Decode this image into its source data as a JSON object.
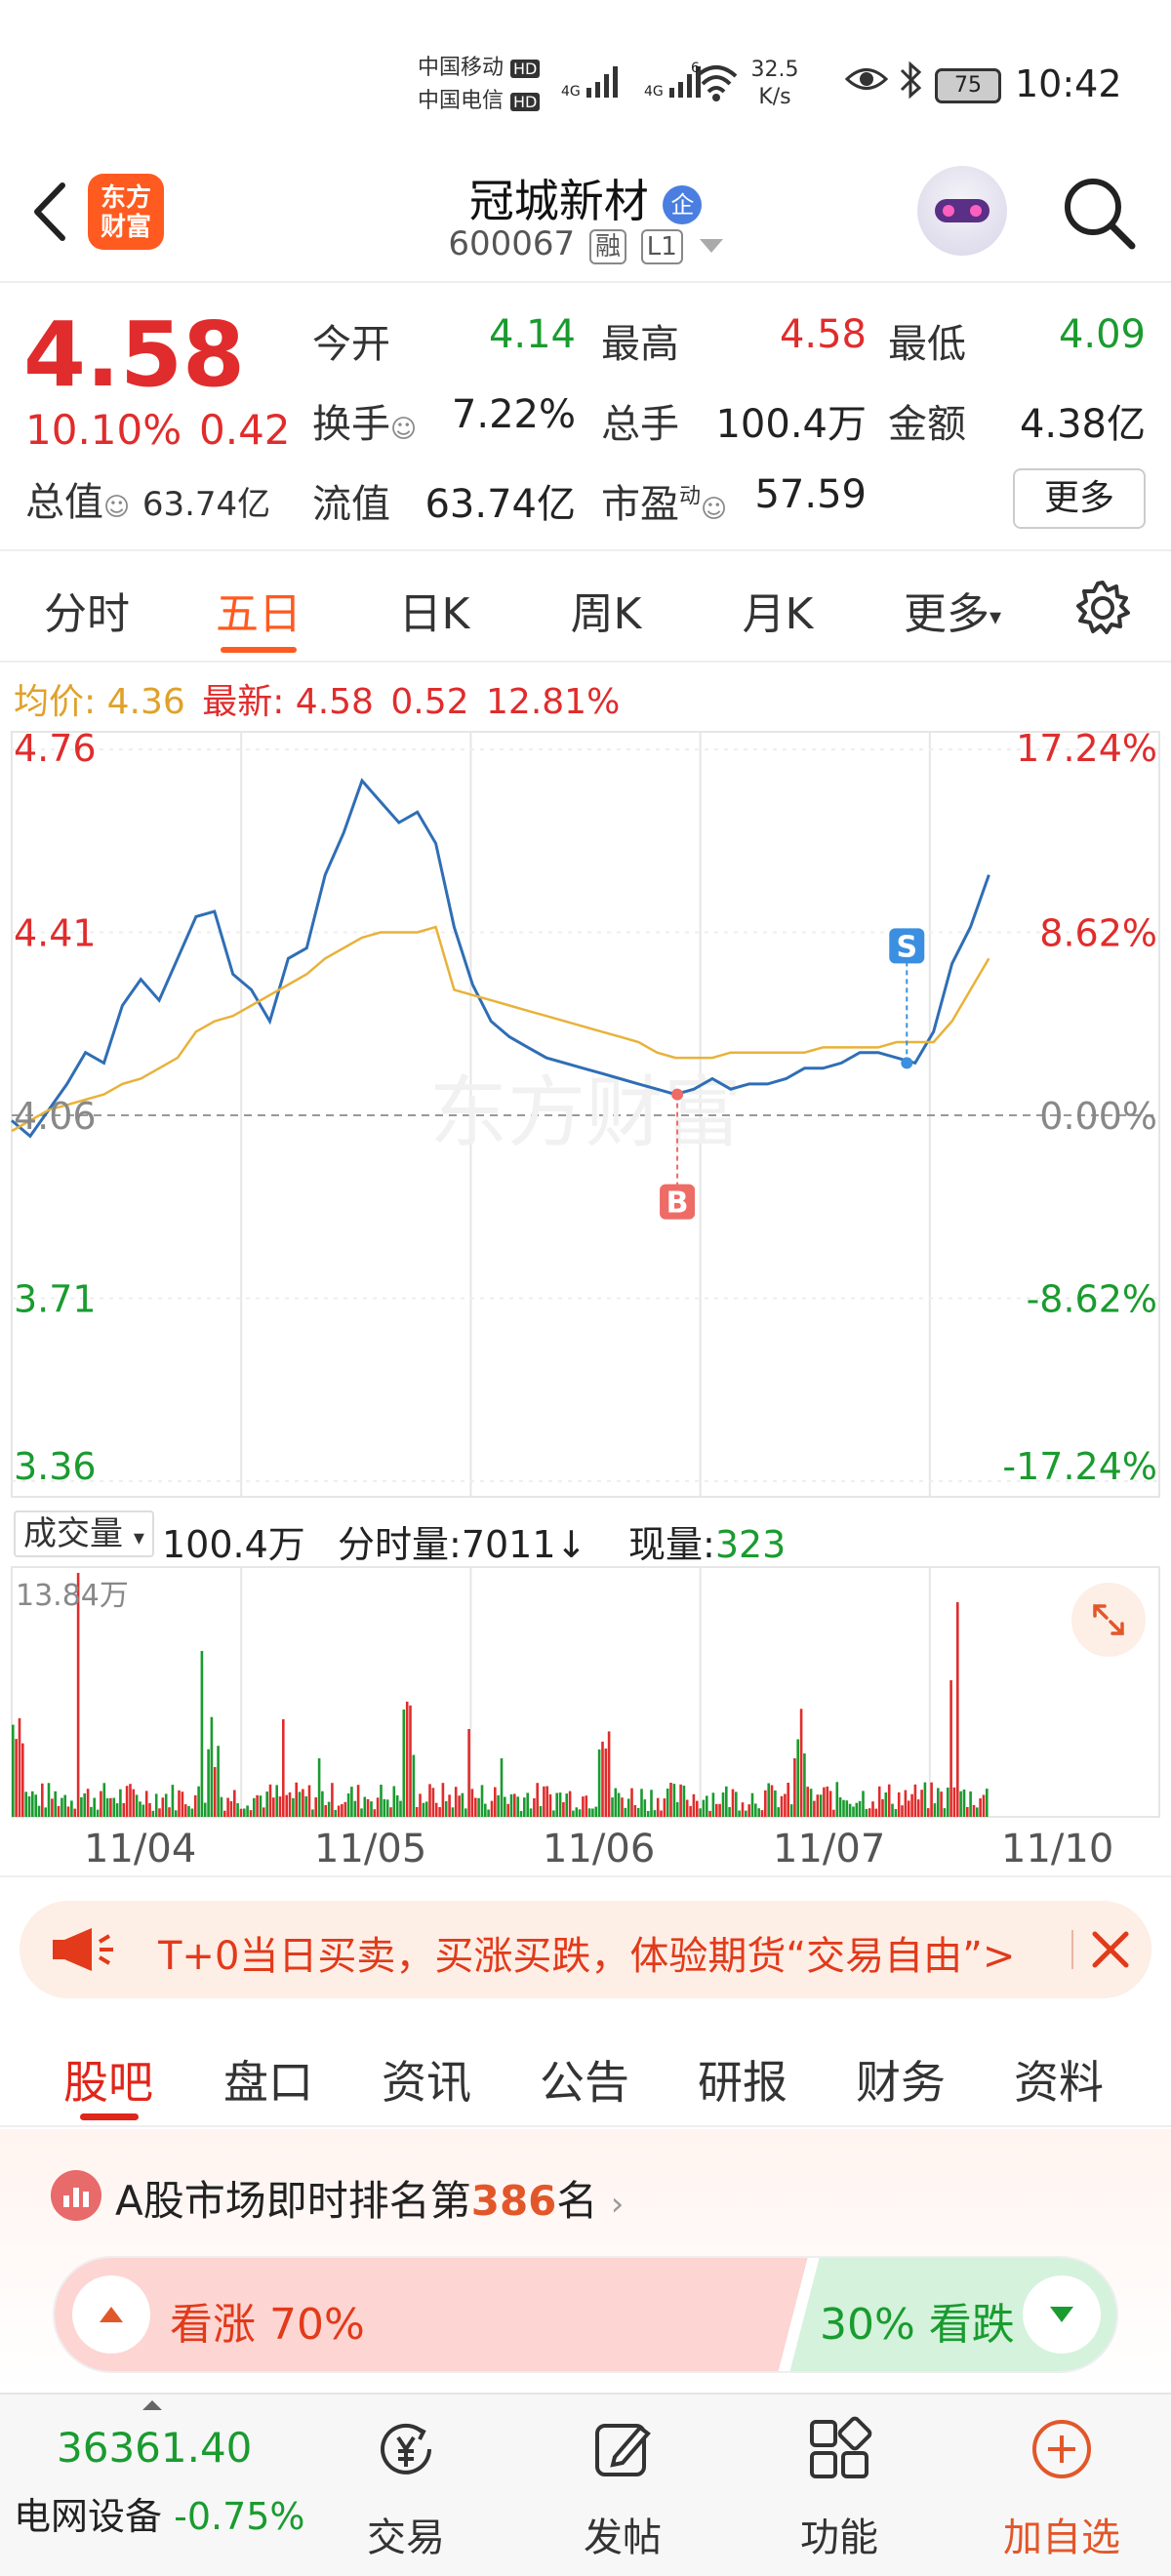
{
  "status_bar": {
    "carrier1": "中国移动",
    "carrier2": "中国电信",
    "hd": "HD",
    "net1": "4G",
    "net2": "4G",
    "wifi_label": "6",
    "speed_value": "32.5",
    "speed_unit": "K/s",
    "battery": "75",
    "time": "10:42"
  },
  "header": {
    "back_icon": "chevron-left-icon",
    "logo_text_1": "东方",
    "logo_text_2": "财富",
    "stock_name": "冠城新材",
    "enterprise_badge": "企",
    "stock_code": "600067",
    "tag_margin": "融",
    "tag_level": "L1",
    "search_icon": "search-icon"
  },
  "quote": {
    "price": "4.58",
    "change_pct": "10.10%",
    "change_amt": "0.42",
    "total_value_label": "总值",
    "total_value": "63.74亿",
    "open_label": "今开",
    "open": "4.14",
    "high_label": "最高",
    "high": "4.58",
    "low_label": "最低",
    "low": "4.09",
    "turnover_label": "换手",
    "turnover": "7.22%",
    "volume_label": "总手",
    "volume": "100.4万",
    "amount_label": "金额",
    "amount": "4.38亿",
    "float_label": "流值",
    "float": "63.74亿",
    "pe_label": "市盈",
    "pe_sup": "动",
    "pe": "57.59",
    "more": "更多"
  },
  "tabs": {
    "items": [
      "分时",
      "五日",
      "日K",
      "周K",
      "月K",
      "更多"
    ],
    "active": "五日"
  },
  "info": {
    "avg_label": "均价:",
    "avg": "4.36",
    "latest_label": "最新:",
    "latest": "4.58",
    "chg": "0.52",
    "pct": "12.81%"
  },
  "chart_data": {
    "type": "line",
    "title": "",
    "price_axis": [
      "4.76",
      "4.41",
      "4.06",
      "3.71",
      "3.36"
    ],
    "pct_axis": [
      "17.24%",
      "8.62%",
      "0.00%",
      "-8.62%",
      "-17.24%"
    ],
    "x": [
      "11/04",
      "11/05",
      "11/06",
      "11/07",
      "11/10"
    ],
    "series": [
      {
        "values": [
          4.05,
          4.02,
          4.07,
          4.12,
          4.18,
          4.16,
          4.27,
          4.32,
          4.28,
          4.36,
          4.44,
          4.45,
          4.33,
          4.3,
          4.24,
          4.36,
          4.38,
          4.52,
          4.6,
          4.7,
          4.66,
          4.62,
          4.64,
          4.58,
          4.42,
          4.31,
          4.24,
          4.21,
          4.19,
          4.17,
          4.16,
          4.15,
          4.14,
          4.13,
          4.12,
          4.11,
          4.1,
          4.11,
          4.13,
          4.11,
          4.12,
          4.12,
          4.13,
          4.15,
          4.15,
          4.16,
          4.18,
          4.18,
          4.17,
          4.16,
          4.22,
          4.35,
          4.42,
          4.52
        ]
      },
      {
        "values": [
          4.03,
          4.05,
          4.07,
          4.08,
          4.09,
          4.1,
          4.12,
          4.13,
          4.15,
          4.17,
          4.22,
          4.24,
          4.25,
          4.27,
          4.29,
          4.31,
          4.33,
          4.36,
          4.38,
          4.4,
          4.41,
          4.41,
          4.41,
          4.42,
          4.3,
          4.29,
          4.28,
          4.27,
          4.26,
          4.25,
          4.24,
          4.23,
          4.22,
          4.21,
          4.2,
          4.18,
          4.17,
          4.17,
          4.17,
          4.18,
          4.18,
          4.18,
          4.18,
          4.18,
          4.19,
          4.19,
          4.19,
          4.19,
          4.2,
          4.2,
          4.2,
          4.24,
          4.3,
          4.36
        ]
      }
    ],
    "markers": [
      {
        "label": "B",
        "day": "11/06"
      },
      {
        "label": "S",
        "day": "11/07"
      }
    ],
    "watermark": "东方财富"
  },
  "volume": {
    "label": "成交量",
    "total": "100.4万",
    "fenshi_label": "分时量:",
    "fenshi": "7011",
    "arrow": "↓",
    "now_label": "现量:",
    "now": "323",
    "max": "13.84万"
  },
  "banner": {
    "text": "T+0当日买卖，买涨买跌，体验期货“交易自由”>",
    "icon": "megaphone-icon"
  },
  "subtabs": {
    "items": [
      "股吧",
      "盘口",
      "资讯",
      "公告",
      "研报",
      "财务",
      "资料"
    ],
    "active": "股吧"
  },
  "rank": {
    "prefix": "A股市场即时排名第",
    "num": "386",
    "suffix": "名",
    "up_label": "看涨 70%",
    "up_pct": 0.7,
    "down_label": "30% 看跌"
  },
  "bottomnav": {
    "index_value": "36361.40",
    "index_name": "电网设备",
    "index_chg": "-0.75%",
    "trade": "交易",
    "post": "发帖",
    "func": "功能",
    "add": "加自选"
  }
}
